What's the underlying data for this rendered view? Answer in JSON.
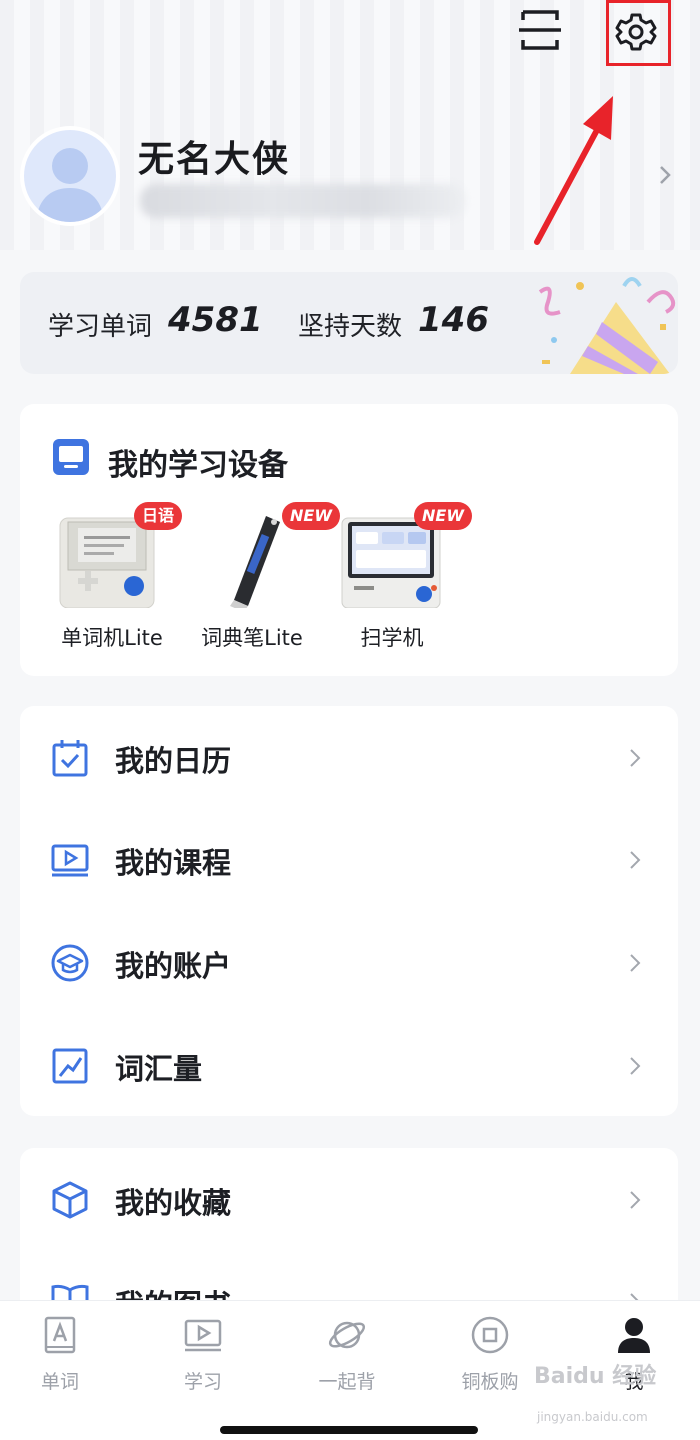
{
  "profile": {
    "username": "无名大侠"
  },
  "stats": {
    "words_label": "学习单词",
    "words_value": "4581",
    "days_label": "坚持天数",
    "days_value": "146"
  },
  "devices": {
    "title": "我的学习设备",
    "items": [
      {
        "label": "单词机Lite",
        "badge": "日语"
      },
      {
        "label": "词典笔Lite",
        "badge": "NEW"
      },
      {
        "label": "扫学机",
        "badge": "NEW"
      }
    ]
  },
  "menu": {
    "items": [
      {
        "label": "我的日历",
        "icon": "calendar-icon"
      },
      {
        "label": "我的课程",
        "icon": "course-icon"
      },
      {
        "label": "我的账户",
        "icon": "account-icon"
      },
      {
        "label": "词汇量",
        "icon": "chart-icon"
      }
    ],
    "items2": [
      {
        "label": "我的收藏",
        "icon": "cube-icon"
      },
      {
        "label": "我的图书",
        "icon": "book-icon"
      }
    ]
  },
  "tabs": [
    {
      "label": "单词",
      "icon": "word-card-icon"
    },
    {
      "label": "学习",
      "icon": "video-icon"
    },
    {
      "label": "一起背",
      "icon": "planet-icon"
    },
    {
      "label": "铜板购",
      "icon": "shop-icon"
    },
    {
      "label": "我",
      "icon": "person-icon"
    }
  ],
  "watermark": {
    "text": "Baidu 经验",
    "sub": "jingyan.baidu.com"
  },
  "colors": {
    "accent": "#3f6fd8",
    "badge": "#ea3639",
    "highlight": "#e8232a"
  }
}
